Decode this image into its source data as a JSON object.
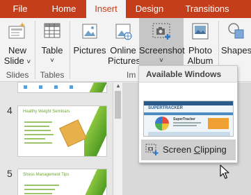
{
  "tabs": [
    {
      "label": "File"
    },
    {
      "label": "Home"
    },
    {
      "label": "Insert",
      "active": true
    },
    {
      "label": "Design"
    },
    {
      "label": "Transitions"
    }
  ],
  "ribbon": {
    "buttons": {
      "new_slide": {
        "line1": "New",
        "line2": "Slide",
        "dropdown": "˅"
      },
      "table": {
        "line1": "Table",
        "dropdown": "˅"
      },
      "pictures": {
        "line1": "Pictures"
      },
      "online_pictures": {
        "line1": "Online",
        "line2": "Pictures"
      },
      "screenshot": {
        "line1": "Screenshot",
        "dropdown": "˅"
      },
      "photo_album": {
        "line1": "Photo",
        "line2": "Album",
        "dropdown": "˅"
      },
      "shapes": {
        "line1": "Shapes"
      }
    },
    "groups": {
      "slides": "Slides",
      "tables": "Tables",
      "images": "Im"
    }
  },
  "slide_panel": {
    "slides": [
      {
        "number": "4",
        "title": "Healthy Weight Seminars"
      },
      {
        "number": "5",
        "title": "Stress Management Tips"
      }
    ]
  },
  "dropdown": {
    "header": "Available Windows",
    "window_thumb": {
      "title": "SUPERTRACKER",
      "subtitle": "SuperTracker"
    },
    "screen_clipping": {
      "label_pre": "Screen ",
      "label_u": "C",
      "label_post": "lipping"
    }
  },
  "colors": {
    "accent": "#c43e1c",
    "ribbon_bg": "#f3f3f3",
    "selected_button": "#c6c6c6",
    "slide_green": "#6aa82c"
  },
  "icons": {
    "new_slide": "new-slide-icon",
    "table": "table-icon",
    "pictures": "pictures-icon",
    "online_pictures": "online-pictures-icon",
    "screenshot": "screenshot-icon",
    "photo_album": "photo-album-icon",
    "shapes": "shapes-icon",
    "screen_clipping": "screen-clipping-icon",
    "cursor": "mouse-pointer-icon"
  }
}
